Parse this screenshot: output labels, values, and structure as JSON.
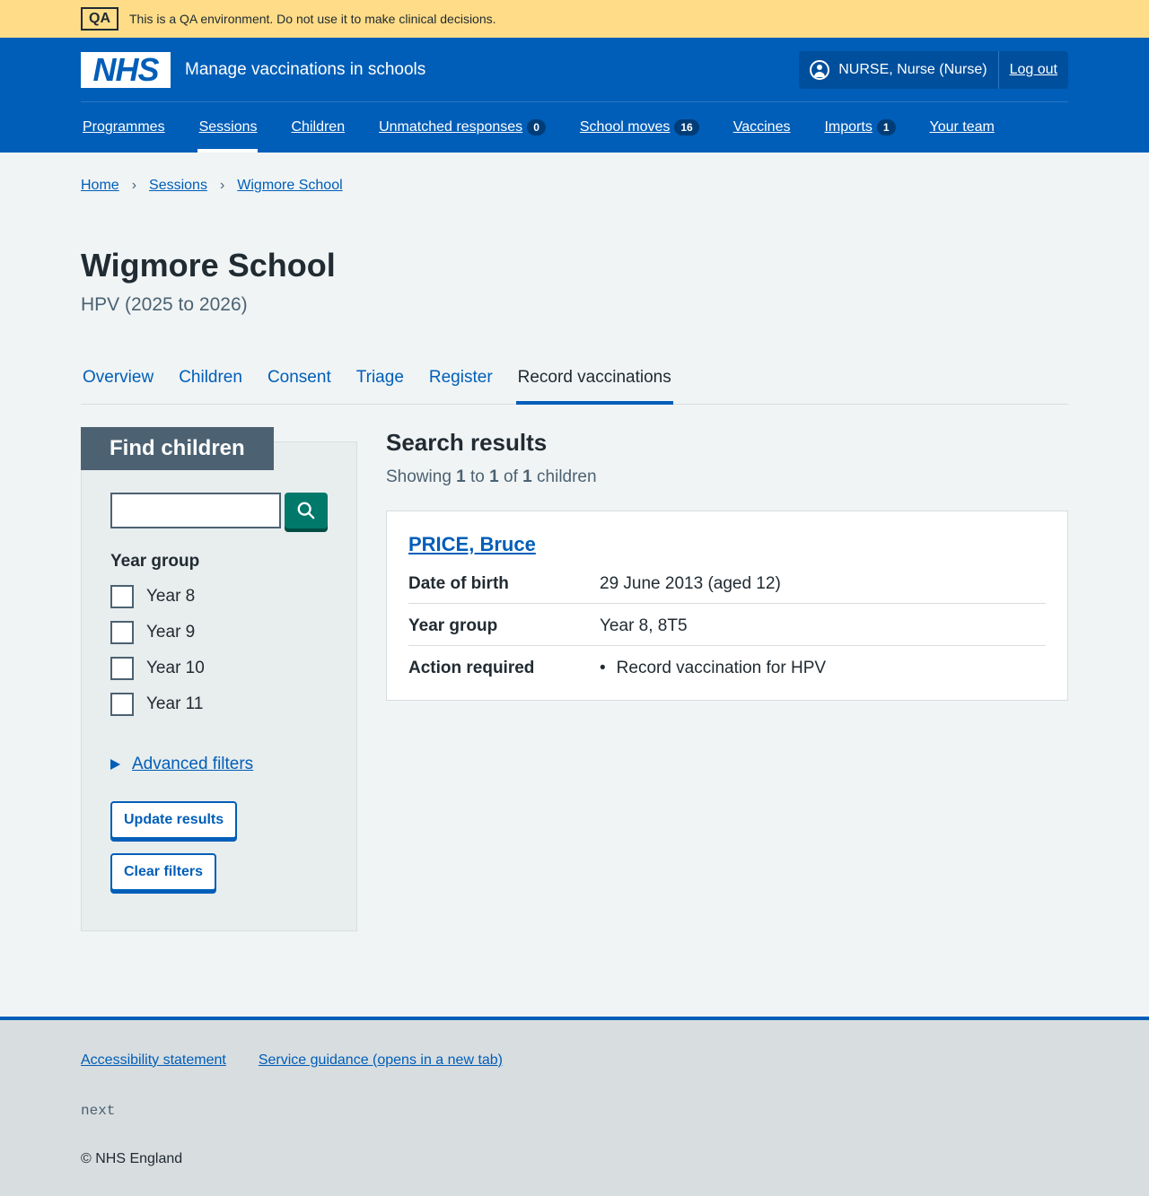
{
  "qa_banner": {
    "tag": "QA",
    "text": "This is a QA environment. Do not use it to make clinical decisions."
  },
  "header": {
    "logo": "NHS",
    "service_name": "Manage vaccinations in schools",
    "user": "NURSE, Nurse (Nurse)",
    "logout": "Log out"
  },
  "nav": [
    {
      "label": "Programmes",
      "count": null
    },
    {
      "label": "Sessions",
      "count": null
    },
    {
      "label": "Children",
      "count": null
    },
    {
      "label": "Unmatched responses",
      "count": "0"
    },
    {
      "label": "School moves",
      "count": "16"
    },
    {
      "label": "Vaccines",
      "count": null
    },
    {
      "label": "Imports",
      "count": "1"
    },
    {
      "label": "Your team",
      "count": null
    }
  ],
  "breadcrumb": [
    "Home",
    "Sessions",
    "Wigmore School"
  ],
  "page": {
    "title": "Wigmore School",
    "caption": "HPV (2025 to 2026)"
  },
  "tabs": [
    "Overview",
    "Children",
    "Consent",
    "Triage",
    "Register",
    "Record vaccinations"
  ],
  "filters": {
    "heading": "Find children",
    "search_value": "",
    "year_group_legend": "Year group",
    "year_options": [
      "Year 8",
      "Year 9",
      "Year 10",
      "Year 11"
    ],
    "advanced": "Advanced filters",
    "update": "Update results",
    "clear": "Clear filters"
  },
  "results": {
    "heading": "Search results",
    "showing_pre": "Showing",
    "from": "1",
    "to_word": "to",
    "to": "1",
    "of_word": "of",
    "total": "1",
    "noun": "children",
    "card": {
      "name": "PRICE, Bruce",
      "rows": [
        {
          "key": "Date of birth",
          "value": "29 June 2013 (aged 12)"
        },
        {
          "key": "Year group",
          "value": "Year 8, 8T5"
        },
        {
          "key": "Action required",
          "value": "Record vaccination for HPV"
        }
      ]
    }
  },
  "footer": {
    "links": [
      "Accessibility statement",
      "Service guidance (opens in a new tab)"
    ],
    "version": "next",
    "copyright": "© NHS England"
  },
  "colors": {
    "nhs_blue": "#005eb8",
    "qa_yellow": "#ffdd88",
    "search_button": "#00796b",
    "filter_head": "#4c6272"
  }
}
